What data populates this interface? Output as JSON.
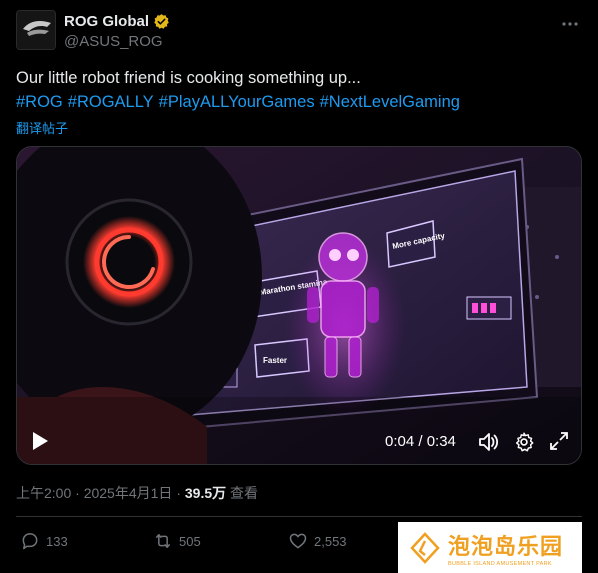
{
  "account": {
    "name": "ROG Global",
    "handle": "@ASUS_ROG",
    "avatar_logo_text": "ROG"
  },
  "tweet": {
    "text": "Our little robot friend is cooking something up...",
    "hashtags": [
      "#ROG",
      "#ROGALLY",
      "#PlayALLYourGames",
      "#NextLevelGaming"
    ],
    "translate_label": "翻译帖子"
  },
  "video": {
    "current_time": "0:04",
    "duration": "0:34",
    "time_display": "0:04 / 0:34",
    "screen_labels": {
      "label_1": "Marathon stamina",
      "label_2": "More capacity",
      "label_3": "Faster"
    }
  },
  "meta": {
    "time": "上午2:00",
    "date": "2025年4月1日",
    "views": "39.5万",
    "views_label": "查看"
  },
  "actions": {
    "replies": "133",
    "reposts": "505",
    "likes": "2,553"
  },
  "watermark": {
    "title": "泡泡岛乐园",
    "subtitle": "BUBBLE ISLAND AMUSEMENT PARK"
  },
  "colors": {
    "link": "#1d9bf0",
    "verified": "#e2b719",
    "muted": "#71767b",
    "accent_red": "#ff3b2f",
    "hologram": "#e040fb"
  }
}
